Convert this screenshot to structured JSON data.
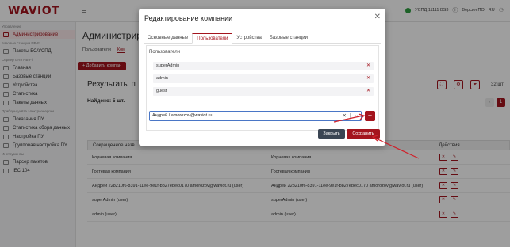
{
  "app": {
    "logo": "WAVIOT"
  },
  "topbar": {
    "status_label": "УСПД 11111 BS3",
    "version_label": "Версия ПО",
    "lang_label": "RU"
  },
  "sidebar": {
    "sections": [
      {
        "title": "Управление",
        "items": [
          {
            "label": "Администрирование",
            "active": true
          }
        ]
      },
      {
        "title": "Базовые станции NB-Fi",
        "items": [
          {
            "label": "Пакеты БС/УСПД"
          }
        ]
      },
      {
        "title": "Сервер сети NB-Fi",
        "items": [
          {
            "label": "Главная"
          },
          {
            "label": "Базовые станции"
          },
          {
            "label": "Устройства"
          },
          {
            "label": "Статистика"
          },
          {
            "label": "Пакеты данных"
          }
        ]
      },
      {
        "title": "Приборы учёта электроэнергии",
        "items": [
          {
            "label": "Показания ПУ"
          },
          {
            "label": "Статистика сбора данных"
          },
          {
            "label": "Настройка ПУ"
          },
          {
            "label": "Групповая настройка ПУ"
          }
        ]
      },
      {
        "title": "Инструменты",
        "items": [
          {
            "label": "Парсер пакетов"
          },
          {
            "label": "IEC 104"
          }
        ]
      }
    ]
  },
  "main": {
    "page_title": "Администрир",
    "subtabs": [
      "Пользователи",
      "Ком"
    ],
    "add_button": "+ Добавить компан",
    "results_title": "Результаты п",
    "found_label": "Найдено: 5 шт.",
    "count_label": "32 шт",
    "pager_current": "1",
    "table": {
      "headers": [
        "Сокращенное назв",
        "",
        "Действия"
      ],
      "rows": [
        {
          "short": "Корневая компания",
          "full": "Корневая компания"
        },
        {
          "short": "Гостевая компания",
          "full": "Гостевая компания"
        },
        {
          "short": "Андрей 228210f6-8391-11ee-9e1f-b827ebec0170 amorozov@waviot.ru (user)",
          "full": "Андрей 228210f6-8391-11ee-9e1f-b827ebec0170 amorozov@waviot.ru (user)"
        },
        {
          "short": "superAdmin (user)",
          "full": "superAdmin (user)"
        },
        {
          "short": "admin (user)",
          "full": "admin (user)"
        }
      ]
    }
  },
  "modal": {
    "title": "Редактирование компании",
    "tabs": [
      "Основные данные",
      "Пользователи",
      "Устройства",
      "Базовые станции"
    ],
    "active_tab": "Пользователи",
    "panel_label": "Пользователи",
    "users": [
      "superAdmin",
      "admin",
      "guest"
    ],
    "select_value": "Андрей / amorozov@waviot.ru",
    "close_button": "Закрыть",
    "save_button": "Сохранить"
  },
  "colors": {
    "brand": "#a4141d",
    "dark_button": "#3a4553",
    "status_green": "#2e9d3f",
    "arrow": "#d0202a"
  },
  "icons": [
    "hamburger-icon",
    "close-icon",
    "remove-icon",
    "clear-icon",
    "chevron-down-icon",
    "plus-icon",
    "delete-icon",
    "edit-icon"
  ]
}
